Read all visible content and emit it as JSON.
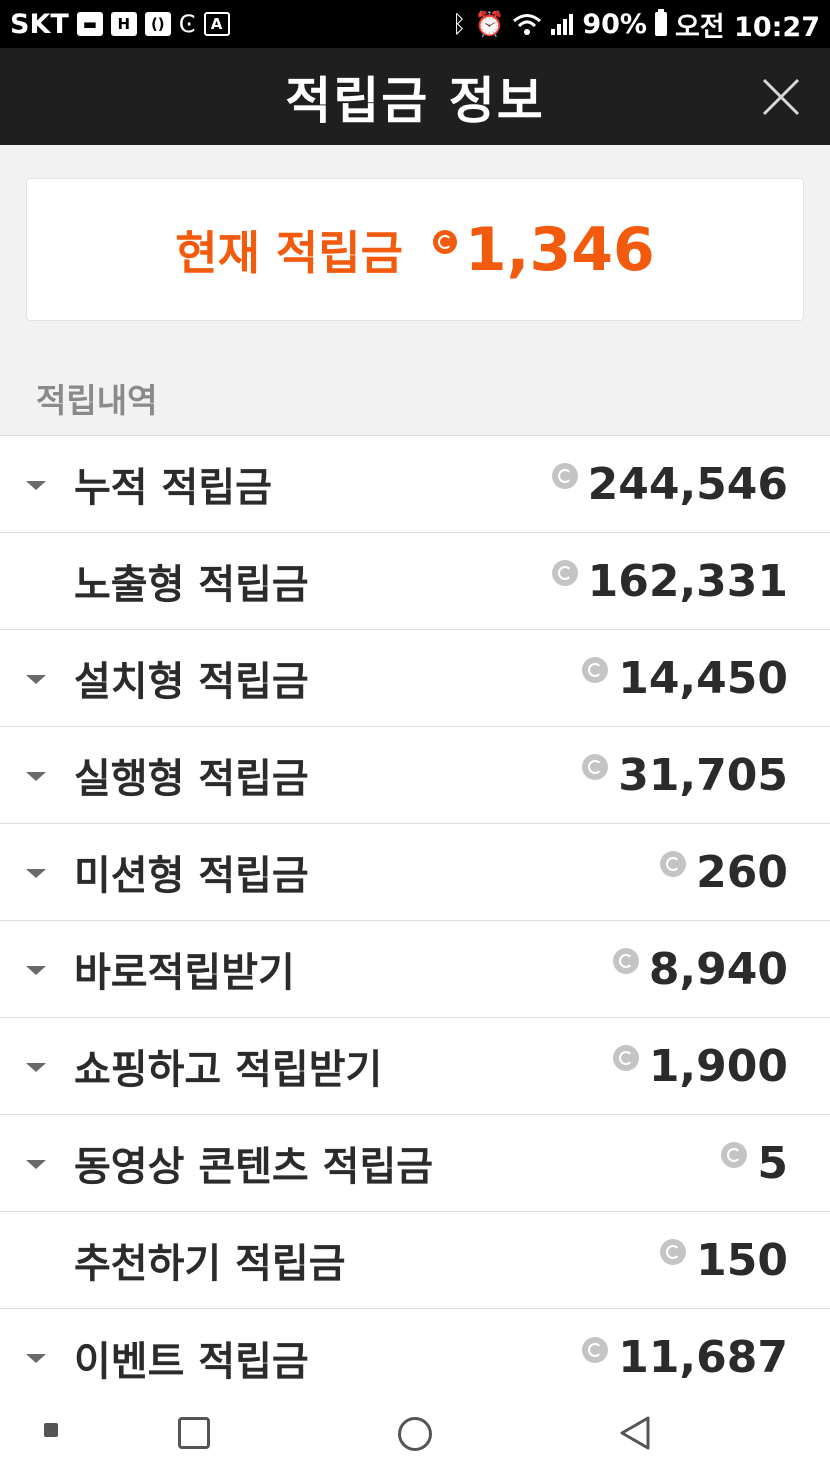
{
  "status_bar": {
    "carrier": "SKT",
    "battery": "90%",
    "time": "오전 10:27",
    "icons": [
      "notification-icon",
      "h-icon",
      "bracket-icon",
      "c-icon",
      "a-icon",
      "bluetooth-icon",
      "alarm-icon",
      "wifi-icon",
      "signal-icon",
      "battery-icon"
    ]
  },
  "header": {
    "title": "적립금 정보",
    "close_icon": "close-icon"
  },
  "current_points": {
    "label": "현재 적립금",
    "value": "1,346",
    "accent_color": "#f25a0e"
  },
  "section_title": "적립내역",
  "history": [
    {
      "label": "누적 적립금",
      "value": "244,546",
      "expandable": true
    },
    {
      "label": "노출형 적립금",
      "value": "162,331",
      "expandable": false
    },
    {
      "label": "설치형 적립금",
      "value": "14,450",
      "expandable": true
    },
    {
      "label": "실행형 적립금",
      "value": "31,705",
      "expandable": true
    },
    {
      "label": "미션형 적립금",
      "value": "260",
      "expandable": true
    },
    {
      "label": "바로적립받기",
      "value": "8,940",
      "expandable": true
    },
    {
      "label": "쇼핑하고 적립받기",
      "value": "1,900",
      "expandable": true
    },
    {
      "label": "동영상 콘텐츠 적립금",
      "value": "5",
      "expandable": true
    },
    {
      "label": "추천하기 적립금",
      "value": "150",
      "expandable": false
    },
    {
      "label": "이벤트 적립금",
      "value": "11,687",
      "expandable": true
    }
  ],
  "nav_bar": {
    "buttons": [
      "recent-dot-icon",
      "overview-square-icon",
      "home-circle-icon",
      "back-triangle-icon"
    ]
  }
}
